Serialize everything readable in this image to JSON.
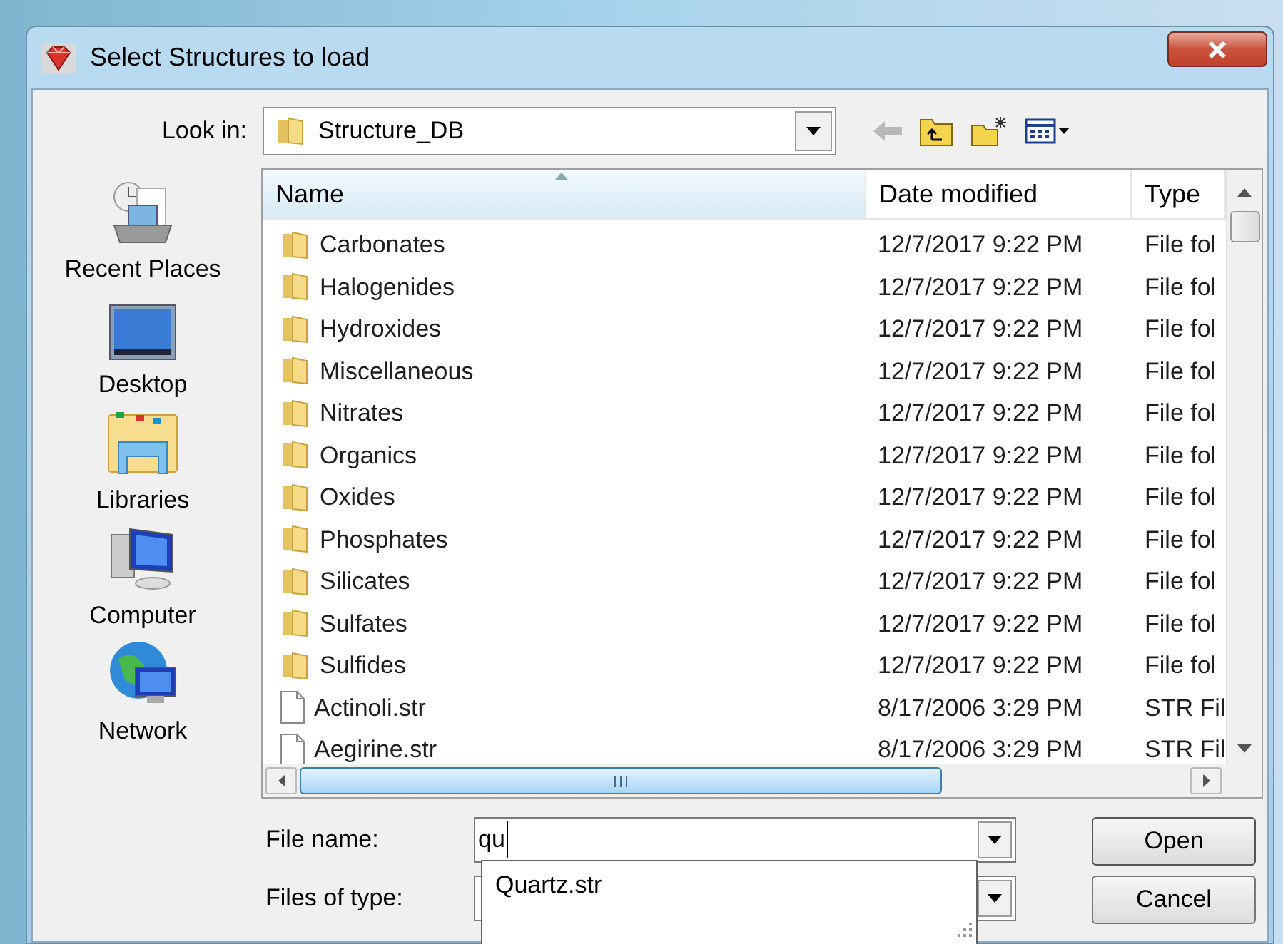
{
  "window": {
    "title": "Select Structures to load"
  },
  "look_in": {
    "label": "Look in:",
    "value": "Structure_DB"
  },
  "toolbar": [
    {
      "kind": "back",
      "disabled": true
    },
    {
      "kind": "up"
    },
    {
      "kind": "new-folder"
    },
    {
      "kind": "view"
    }
  ],
  "sidebar": {
    "items": [
      {
        "kind": "recent",
        "label": "Recent Places"
      },
      {
        "kind": "desktop",
        "label": "Desktop"
      },
      {
        "kind": "libraries",
        "label": "Libraries"
      },
      {
        "kind": "computer",
        "label": "Computer"
      },
      {
        "kind": "network",
        "label": "Network"
      }
    ]
  },
  "table": {
    "columns": [
      "Name",
      "Date modified",
      "Type"
    ],
    "rows": [
      {
        "kind": "folder",
        "name": "Carbonates",
        "date": "12/7/2017 9:22 PM",
        "type": "File fol"
      },
      {
        "kind": "folder",
        "name": "Halogenides",
        "date": "12/7/2017 9:22 PM",
        "type": "File fol"
      },
      {
        "kind": "folder",
        "name": "Hydroxides",
        "date": "12/7/2017 9:22 PM",
        "type": "File fol"
      },
      {
        "kind": "folder",
        "name": "Miscellaneous",
        "date": "12/7/2017 9:22 PM",
        "type": "File fol"
      },
      {
        "kind": "folder",
        "name": "Nitrates",
        "date": "12/7/2017 9:22 PM",
        "type": "File fol"
      },
      {
        "kind": "folder",
        "name": "Organics",
        "date": "12/7/2017 9:22 PM",
        "type": "File fol"
      },
      {
        "kind": "folder",
        "name": "Oxides",
        "date": "12/7/2017 9:22 PM",
        "type": "File fol"
      },
      {
        "kind": "folder",
        "name": "Phosphates",
        "date": "12/7/2017 9:22 PM",
        "type": "File fol"
      },
      {
        "kind": "folder",
        "name": "Silicates",
        "date": "12/7/2017 9:22 PM",
        "type": "File fol"
      },
      {
        "kind": "folder",
        "name": "Sulfates",
        "date": "12/7/2017 9:22 PM",
        "type": "File fol"
      },
      {
        "kind": "folder",
        "name": "Sulfides",
        "date": "12/7/2017 9:22 PM",
        "type": "File fol"
      },
      {
        "kind": "file",
        "name": "Actinoli.str",
        "date": "8/17/2006 3:29 PM",
        "type": "STR Fil"
      },
      {
        "kind": "file",
        "name": "Aegirine.str",
        "date": "8/17/2006 3:29 PM",
        "type": "STR Fil"
      }
    ]
  },
  "file_name": {
    "label": "File name:",
    "value": "qu"
  },
  "files_of_type": {
    "label": "Files of type:"
  },
  "autocomplete": [
    "Quartz.str"
  ],
  "buttons": [
    "Open",
    "Cancel"
  ]
}
